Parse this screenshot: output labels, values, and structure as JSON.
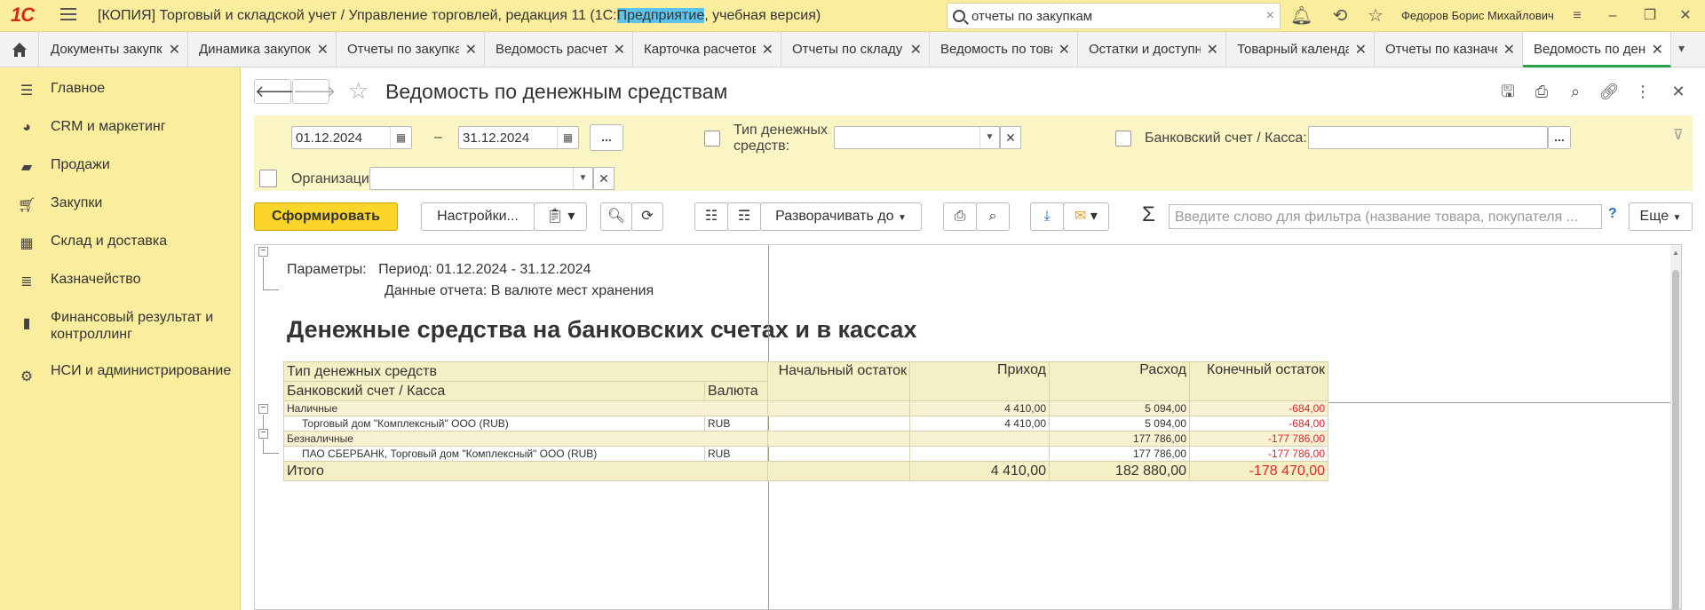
{
  "app": {
    "logo": "1С",
    "title_pre": "[КОПИЯ] Торговый и складской учет / Управление торговлей, редакция 11  (1С:",
    "title_hl": "Предприятие",
    "title_post": ", учебная версия)",
    "search_value": "отчеты по закупкам",
    "user": "Федоров Борис Михайлович"
  },
  "tabs": [
    {
      "label": "Документы закупки"
    },
    {
      "label": "Динамика закупок"
    },
    {
      "label": "Отчеты по закупкам"
    },
    {
      "label": "Ведомость расчетов"
    },
    {
      "label": "Карточка расчетов"
    },
    {
      "label": "Отчеты по складу"
    },
    {
      "label": "Ведомость по товарам"
    },
    {
      "label": "Остатки и доступность"
    },
    {
      "label": "Товарный календарь"
    },
    {
      "label": "Отчеты по казначейству"
    },
    {
      "label": "Ведомость по денежным средствам"
    }
  ],
  "sidebar": {
    "items": [
      {
        "label": "Главное",
        "icon": "menu-icon"
      },
      {
        "label": "CRM и маркетинг",
        "icon": "pie-chart-icon"
      },
      {
        "label": "Продажи",
        "icon": "bag-icon"
      },
      {
        "label": "Закупки",
        "icon": "cart-icon"
      },
      {
        "label": "Склад и доставка",
        "icon": "warehouse-icon"
      },
      {
        "label": "Казначейство",
        "icon": "coins-icon"
      },
      {
        "label": "Финансовый результат и контроллинг",
        "icon": "bar-chart-icon"
      },
      {
        "label": "НСИ и администрирование",
        "icon": "gear-icon"
      }
    ]
  },
  "form": {
    "title": "Ведомость по денежным средствам",
    "date_from": "01.12.2024",
    "date_sep": "–",
    "date_to": "31.12.2024",
    "dots": "...",
    "cash_type_label": "Тип денежных средств:",
    "cash_type_value": "",
    "bank_label": "Банковский счет / Касса:",
    "bank_value": "",
    "org_label": "Организация:",
    "org_value": ""
  },
  "toolbar": {
    "generate": "Сформировать",
    "settings": "Настройки...",
    "expand": "Разворачивать до",
    "filter_placeholder": "Введите слово для фильтра (название товара, покупателя ...",
    "help": "?",
    "more": "Еще"
  },
  "report": {
    "params_label": "Параметры:",
    "period": "Период: 01.12.2024 - 31.12.2024",
    "data_mode": "Данные отчета: В валюте мест хранения",
    "heading": "Денежные средства на банковских счетах и в кассах",
    "col_type": "Тип денежных средств",
    "col_account": "Банковский счет / Касса",
    "col_currency": "Валюта",
    "col_start": "Начальный остаток",
    "col_in": "Приход",
    "col_out": "Расход",
    "col_end": "Конечный остаток",
    "rows": [
      {
        "name": "Наличные",
        "currency": "",
        "start": "",
        "in": "4 410,00",
        "out": "5 094,00",
        "end": "-684,00",
        "group": true
      },
      {
        "name": "Торговый дом \"Комплексный\" ООО (RUB)",
        "currency": "RUB",
        "start": "",
        "in": "4 410,00",
        "out": "5 094,00",
        "end": "-684,00",
        "group": false
      },
      {
        "name": "Безналичные",
        "currency": "",
        "start": "",
        "in": "",
        "out": "177 786,00",
        "end": "-177 786,00",
        "group": true
      },
      {
        "name": "ПАО СБЕРБАНК, Торговый дом \"Комплексный\" ООО (RUB)",
        "currency": "RUB",
        "start": "",
        "in": "",
        "out": "177 786,00",
        "end": "-177 786,00",
        "group": false
      }
    ],
    "total": {
      "label": "Итого",
      "in": "4 410,00",
      "out": "182 880,00",
      "end": "-178 470,00"
    }
  }
}
